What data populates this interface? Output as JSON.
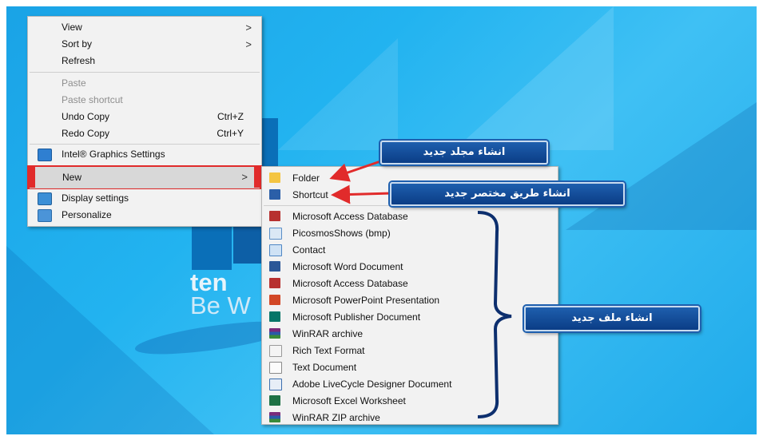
{
  "context_menu": {
    "items": [
      {
        "label": "View",
        "has_submenu": true
      },
      {
        "label": "Sort by",
        "has_submenu": true
      },
      {
        "label": "Refresh"
      },
      {
        "label": "Paste",
        "disabled": true
      },
      {
        "label": "Paste shortcut",
        "disabled": true
      },
      {
        "label": "Undo Copy",
        "shortcut": "Ctrl+Z"
      },
      {
        "label": "Redo Copy",
        "shortcut": "Ctrl+Y"
      },
      {
        "label": "Intel® Graphics Settings",
        "icon": "intel-graphics-icon"
      },
      {
        "label": "New",
        "has_submenu": true,
        "highlighted": true
      },
      {
        "label": "Display settings",
        "icon": "display-icon"
      },
      {
        "label": "Personalize",
        "icon": "personalize-icon"
      }
    ]
  },
  "new_submenu": {
    "items": [
      {
        "label": "Folder",
        "icon": "folder-icon"
      },
      {
        "label": "Shortcut",
        "icon": "shortcut-icon"
      },
      {
        "label": "Microsoft Access Database",
        "icon": "access-icon"
      },
      {
        "label": "PicosmosShows (bmp)",
        "icon": "bitmap-icon"
      },
      {
        "label": "Contact",
        "icon": "contact-icon"
      },
      {
        "label": "Microsoft Word Document",
        "icon": "word-icon"
      },
      {
        "label": "Microsoft Access Database",
        "icon": "access-icon"
      },
      {
        "label": "Microsoft PowerPoint Presentation",
        "icon": "powerpoint-icon"
      },
      {
        "label": "Microsoft Publisher Document",
        "icon": "publisher-icon"
      },
      {
        "label": "WinRAR archive",
        "icon": "winrar-icon"
      },
      {
        "label": "Rich Text Format",
        "icon": "rtf-icon"
      },
      {
        "label": "Text Document",
        "icon": "text-document-icon"
      },
      {
        "label": "Adobe LiveCycle Designer Document",
        "icon": "livecycle-icon"
      },
      {
        "label": "Microsoft Excel Worksheet",
        "icon": "excel-icon"
      },
      {
        "label": "WinRAR ZIP archive",
        "icon": "winrar-zip-icon"
      }
    ]
  },
  "annotations": {
    "new_folder": "انشاء مجلد جديد",
    "new_shortcut": "انشاء طريق مختصر جديد",
    "new_file": "انشاء ملف جديد"
  },
  "wallpaper": {
    "line1": "ten",
    "line2": "Be W"
  },
  "colors": {
    "highlight_border": "#e12b2b",
    "callout_bg": "#1e5fae",
    "arrow": "#e12b2b",
    "brace": "#0d2f6e"
  }
}
